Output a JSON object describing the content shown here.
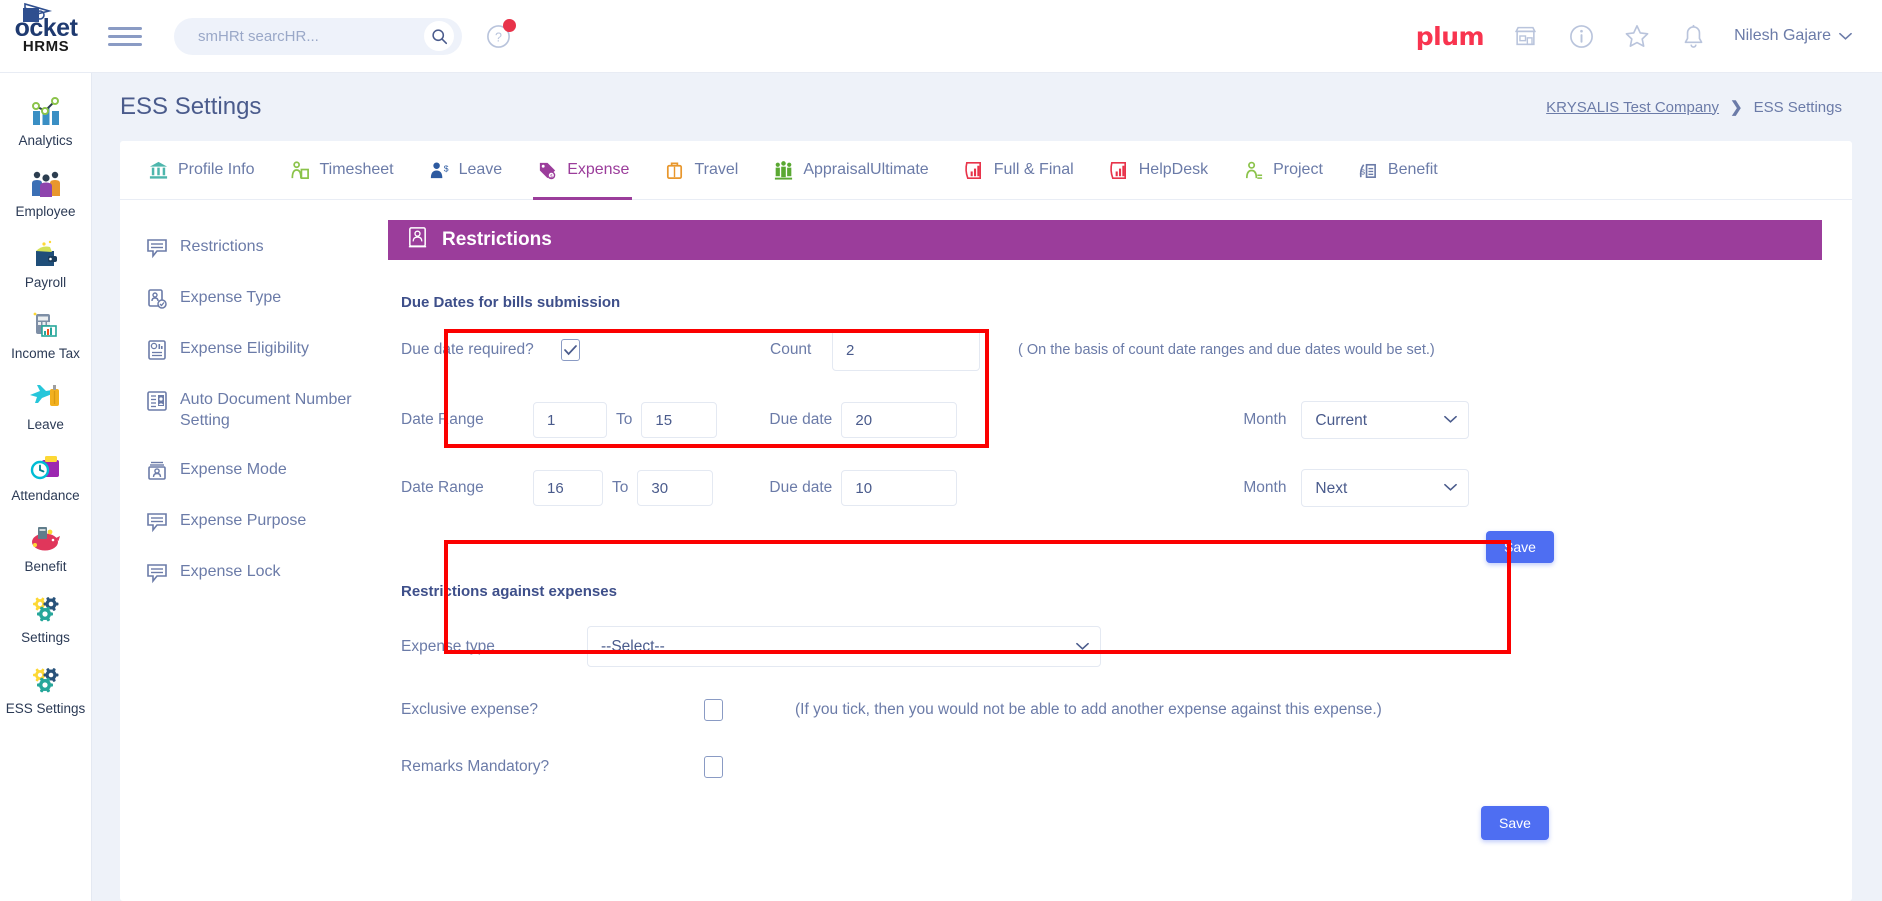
{
  "brand": {
    "logo_main": "ocket",
    "logo_sub": "HRMS",
    "plum": "plum"
  },
  "topbar": {
    "search_placeholder": "smHRt searcHR...",
    "search_value": "",
    "user_name": "Nilesh Gajare"
  },
  "sidebar": {
    "items": [
      {
        "label": "Analytics",
        "icon": "analytics-icon"
      },
      {
        "label": "Employee",
        "icon": "employee-icon"
      },
      {
        "label": "Payroll",
        "icon": "payroll-icon"
      },
      {
        "label": "Income Tax",
        "icon": "income-tax-icon"
      },
      {
        "label": "Leave",
        "icon": "leave-icon"
      },
      {
        "label": "Attendance",
        "icon": "attendance-icon"
      },
      {
        "label": "Benefit",
        "icon": "benefit-icon"
      },
      {
        "label": "Settings",
        "icon": "settings-icon"
      },
      {
        "label": "ESS Settings",
        "icon": "ess-settings-icon"
      }
    ]
  },
  "page": {
    "title": "ESS Settings",
    "breadcrumb_link": "KRYSALIS Test Company",
    "breadcrumb_sep": "❯",
    "breadcrumb_current": "ESS Settings"
  },
  "tabs": [
    {
      "label": "Profile Info",
      "icon": "bank-icon",
      "active": false
    },
    {
      "label": "Timesheet",
      "icon": "timesheet-icon",
      "active": false
    },
    {
      "label": "Leave",
      "icon": "leave-person-icon",
      "active": false
    },
    {
      "label": "Expense",
      "icon": "expense-icon",
      "active": true
    },
    {
      "label": "Travel",
      "icon": "travel-bag-icon",
      "active": false
    },
    {
      "label": "AppraisalUltimate",
      "icon": "appraisal-icon",
      "active": false
    },
    {
      "label": "Full & Final",
      "icon": "full-final-icon",
      "active": false
    },
    {
      "label": "HelpDesk",
      "icon": "helpdesk-icon",
      "active": false
    },
    {
      "label": "Project",
      "icon": "project-icon",
      "active": false
    },
    {
      "label": "Benefit",
      "icon": "benefit-doc-icon",
      "active": false
    }
  ],
  "submenu": [
    {
      "label": "Restrictions",
      "icon": "comment-icon"
    },
    {
      "label": "Expense Type",
      "icon": "expense-type-icon"
    },
    {
      "label": "Expense Eligibility",
      "icon": "eligibility-icon"
    },
    {
      "label": "Auto Document Number Setting",
      "icon": "document-number-icon"
    },
    {
      "label": "Expense Mode",
      "icon": "expense-mode-icon"
    },
    {
      "label": "Expense Purpose",
      "icon": "comment-icon"
    },
    {
      "label": "Expense Lock",
      "icon": "comment-icon"
    }
  ],
  "panel": {
    "title": "Restrictions",
    "icon": "restrictions-icon"
  },
  "due_dates": {
    "section_title": "Due Dates for bills submission",
    "due_date_required_label": "Due date required?",
    "due_date_required_checked": true,
    "count_label": "Count",
    "count_value": "2",
    "count_hint": "( On the basis of count date ranges and due dates would be set.)",
    "rows": [
      {
        "range_label": "Date Range",
        "from": "1",
        "to_label": "To",
        "to": "15",
        "due_label": "Due date",
        "due": "20",
        "month_label": "Month",
        "month": "Current"
      },
      {
        "range_label": "Date Range",
        "from": "16",
        "to_label": "To",
        "to": "30",
        "due_label": "Due date",
        "due": "10",
        "month_label": "Month",
        "month": "Next"
      }
    ],
    "save_label": "Save"
  },
  "restrictions": {
    "section_title": "Restrictions against expenses",
    "expense_type_label": "Expense type",
    "expense_type_value": "--Select--",
    "exclusive_label": "Exclusive expense?",
    "exclusive_checked": false,
    "exclusive_hint": "(If you tick, then you would not be able to add another expense against this expense.)",
    "remarks_label": "Remarks Mandatory?",
    "remarks_checked": false,
    "save_label": "Save"
  },
  "colors": {
    "accent_purple": "#9b3d9b",
    "save_blue": "#4e6ef2",
    "highlight_red": "#fb0000",
    "plum_red": "#f8344f"
  }
}
